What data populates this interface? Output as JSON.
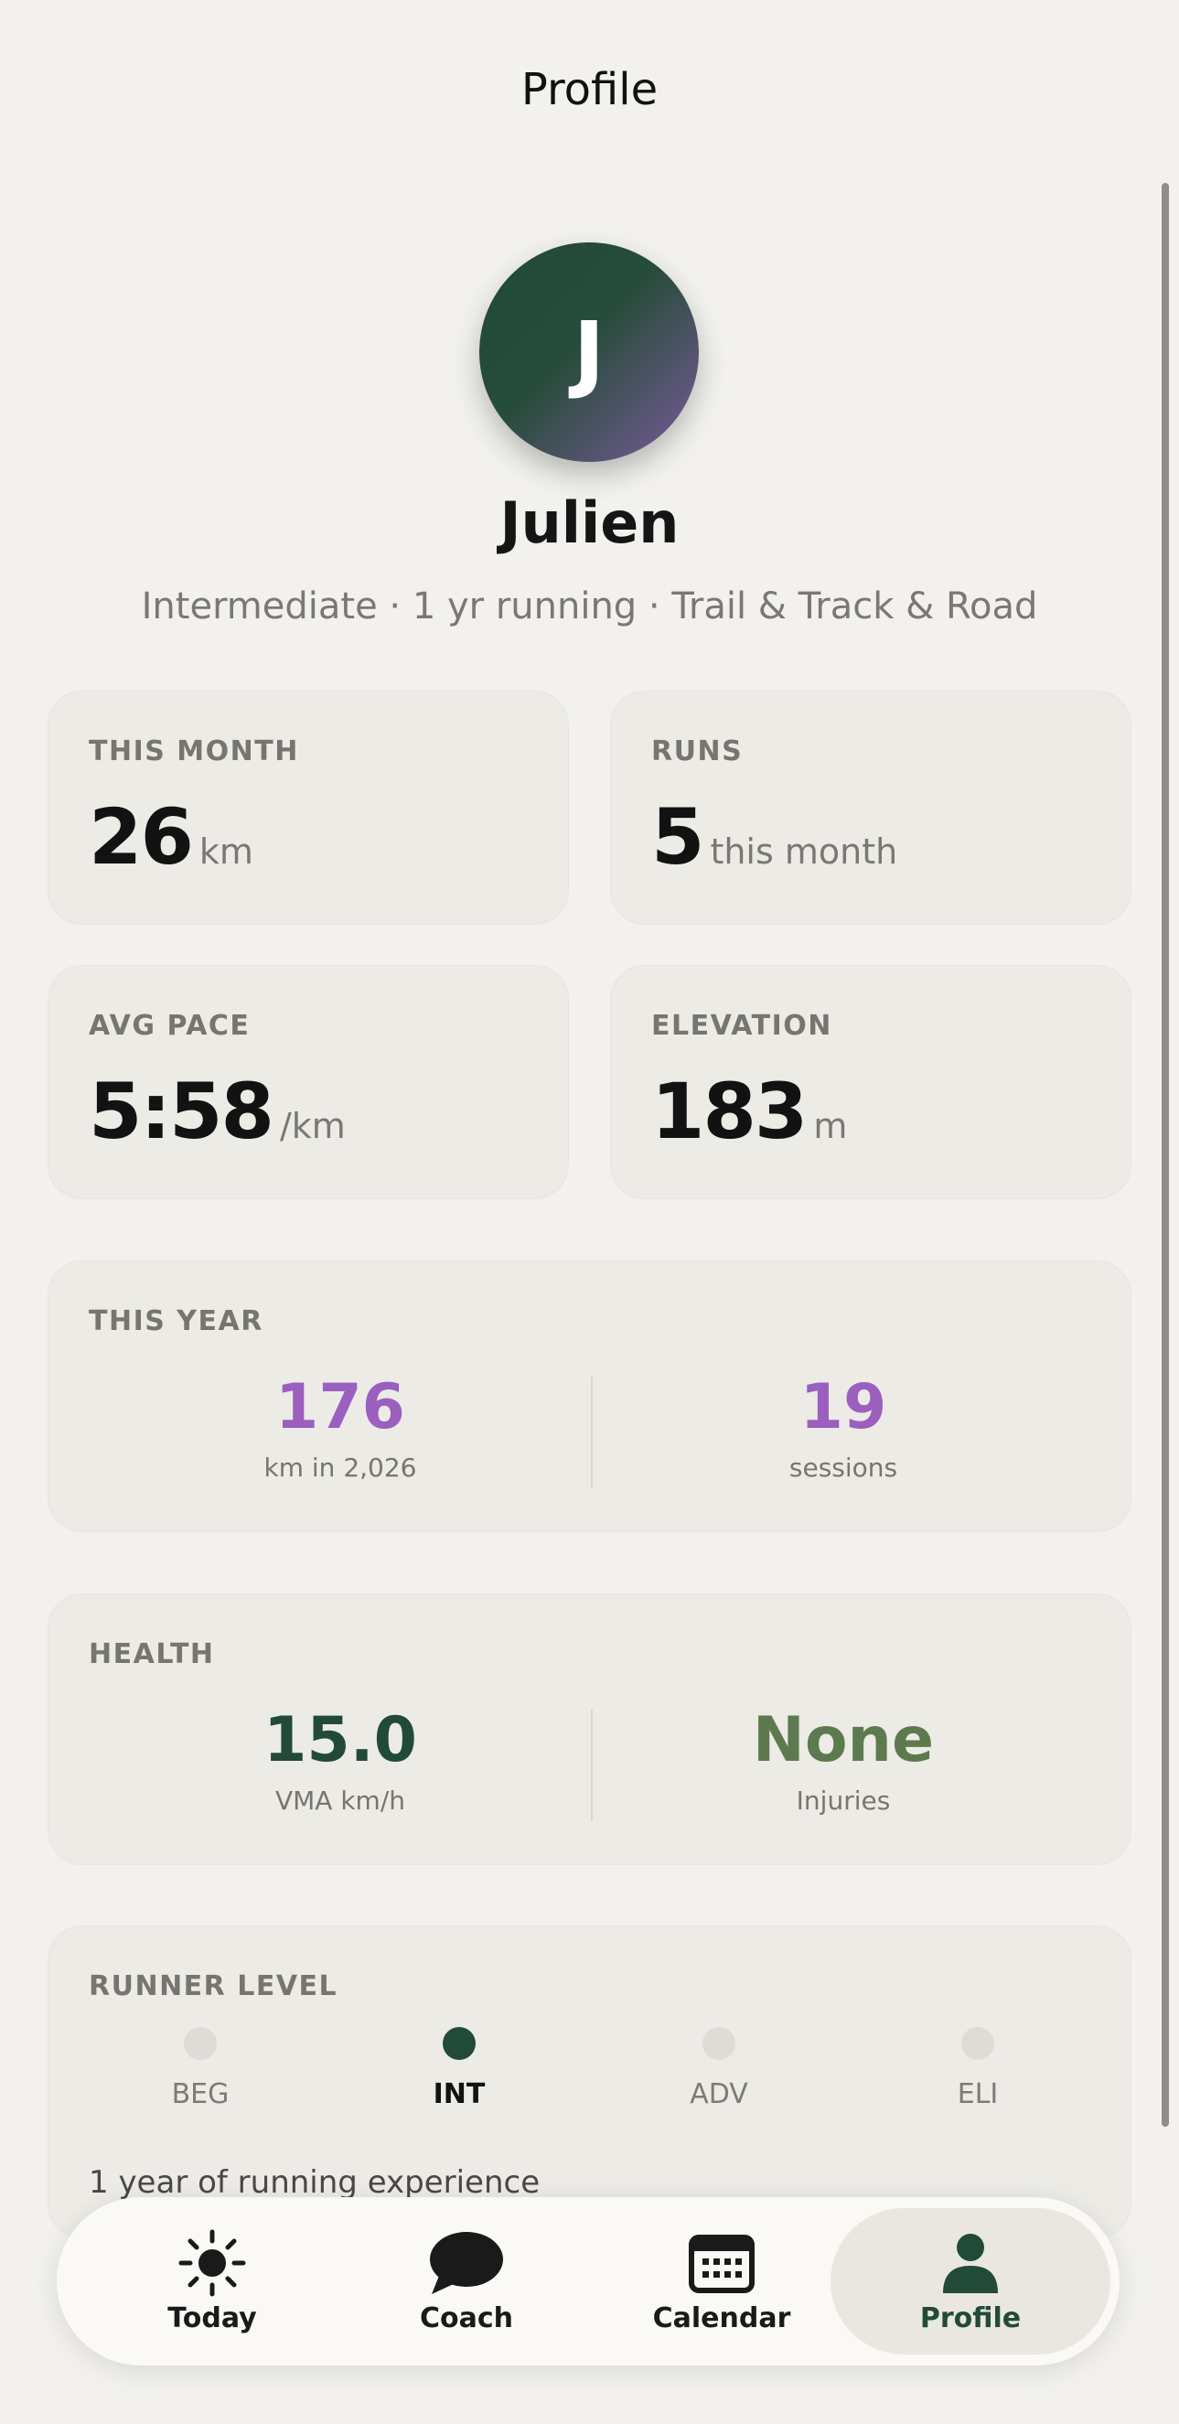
{
  "header": {
    "title": "Profile"
  },
  "profile": {
    "avatar_initial": "J",
    "name": "Julien",
    "subtitle": "Intermediate · 1 yr running · Trail & Track & Road"
  },
  "stats": {
    "this_month": {
      "label": "THIS MONTH",
      "value": "26",
      "unit": "km"
    },
    "runs": {
      "label": "RUNS",
      "value": "5",
      "unit": "this month"
    },
    "avg_pace": {
      "label": "AVG PACE",
      "value": "5:58",
      "unit": "/km"
    },
    "elevation": {
      "label": "ELEVATION",
      "value": "183",
      "unit": "m"
    }
  },
  "this_year": {
    "label": "THIS YEAR",
    "left": {
      "value": "176",
      "caption": "km in 2,026"
    },
    "right": {
      "value": "19",
      "caption": "sessions"
    }
  },
  "health": {
    "label": "HEALTH",
    "left": {
      "value": "15.0",
      "caption": "VMA km/h"
    },
    "right": {
      "value": "None",
      "caption": "Injuries"
    }
  },
  "runner_level": {
    "label": "RUNNER LEVEL",
    "levels": [
      "BEG",
      "INT",
      "ADV",
      "ELI"
    ],
    "active_level": "INT",
    "note": "1 year of running experience"
  },
  "tabs": [
    {
      "label": "Today",
      "icon": "sun-icon"
    },
    {
      "label": "Coach",
      "icon": "chat-bubble-icon"
    },
    {
      "label": "Calendar",
      "icon": "calendar-icon"
    },
    {
      "label": "Profile",
      "icon": "person-icon",
      "active": true
    }
  ],
  "colors": {
    "accent_purple": "#9b5fbf",
    "accent_green_dark": "#224a38",
    "accent_green_olive": "#5d7a4e",
    "background": "#f2f1ed"
  }
}
